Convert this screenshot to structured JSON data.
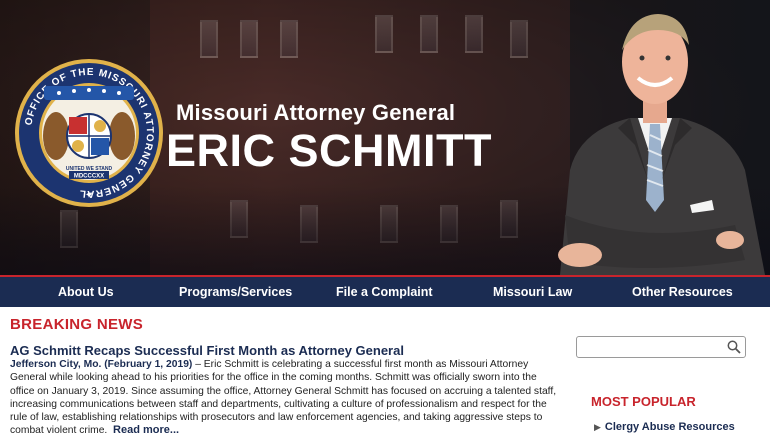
{
  "header": {
    "subtitle": "Missouri Attorney General",
    "name": "ERIC SCHMITT",
    "seal_text": "OFFICE OF THE MISSOURI ATTORNEY GENERAL",
    "seal_year": "MDCCCXX",
    "seal_motto": "UNITED WE STAND"
  },
  "nav": {
    "items": [
      "About Us",
      "Programs/Services",
      "File a Complaint",
      "Missouri Law",
      "Other Resources"
    ]
  },
  "news": {
    "section_title": "BREAKING NEWS",
    "headline": "AG Schmitt Recaps Successful First Month as Attorney General",
    "dateline": "Jefferson City, Mo. (February 1, 2019)",
    "body": " – Eric Schmitt is celebrating a successful first month as Missouri Attorney General while looking ahead to his priorities for the office in the coming months. Schmitt was officially sworn into the office on January 3, 2019. Since assuming the office, Attorney General Schmitt has focused on accruing a talented staff, increasing communications between staff and departments, cultivating a culture of professionalism and respect for the rule of law, establishing relationships with prosecutors and law enforcement agencies, and taking aggressive steps to combat violent crime.",
    "read_more": "Read more..."
  },
  "sidebar": {
    "search_placeholder": "",
    "most_popular_title": "MOST POPULAR",
    "popular_items": [
      "Clergy Abuse Resources"
    ]
  },
  "colors": {
    "navy": "#1b2c52",
    "accent_red": "#c8242c"
  }
}
